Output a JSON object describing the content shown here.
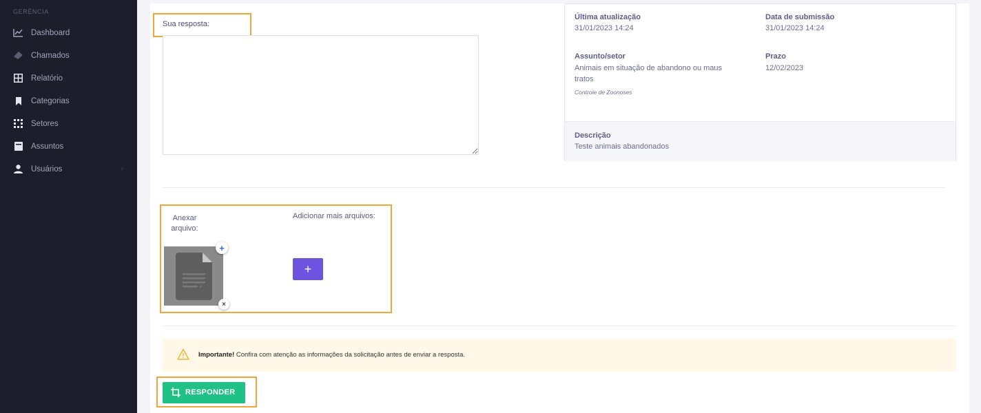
{
  "sidebar": {
    "section_title": "GERÊNCIA",
    "items": [
      {
        "label": "Dashboard",
        "icon": "chart-line-icon"
      },
      {
        "label": "Chamados",
        "icon": "ticket-icon"
      },
      {
        "label": "Relatório",
        "icon": "grid-icon"
      },
      {
        "label": "Categorias",
        "icon": "bookmark-icon"
      },
      {
        "label": "Setores",
        "icon": "dots-grid-icon"
      },
      {
        "label": "Assuntos",
        "icon": "book-icon"
      },
      {
        "label": "Usuários",
        "icon": "user-icon",
        "arrow": "›"
      }
    ]
  },
  "answer": {
    "label": "Sua resposta:",
    "value": ""
  },
  "info": {
    "last_update_title": "Última atualização",
    "last_update_value": "31/01/2023 14:24",
    "submission_title": "Data de submissão",
    "submission_value": "31/01/2023 14:24",
    "subject_title": "Assunto/setor",
    "subject_value": "Animais em situação de abandono ou maus tratos",
    "subject_sector": "Controle de Zoonoses",
    "deadline_title": "Prazo",
    "deadline_value": "12/02/2023",
    "description_title": "Descrição",
    "description_value": "Teste animais abandonados"
  },
  "attachments": {
    "attach_label": "Anexar arquivo:",
    "add_more_label": "Adicionar mais arquivos:",
    "add_badge": "+",
    "remove_badge": "×",
    "add_more_button": "+"
  },
  "alert": {
    "strong": "Importante!",
    "text": " Confira com atenção as informações da solicitação antes de enviar a resposta."
  },
  "actions": {
    "respond_label": "RESPONDER"
  },
  "colors": {
    "sidebar_bg": "#1e1d2b",
    "highlight": "#f0a43a",
    "primary": "#6c54e0",
    "success": "#1fc187",
    "alert_bg": "#fff8e8"
  }
}
